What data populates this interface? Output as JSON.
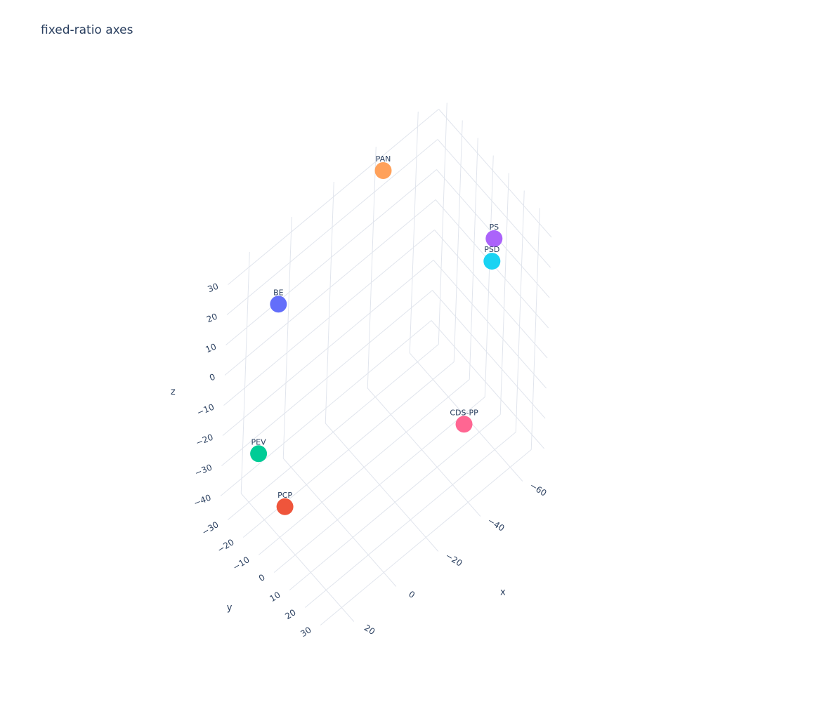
{
  "chart_data": {
    "type": "scatter3d",
    "title": "fixed-ratio axes",
    "xlabel": "x",
    "ylabel": "y",
    "zlabel": "z",
    "xlim": [
      -70,
      30
    ],
    "ylim": [
      -35,
      38
    ],
    "zlim": [
      -45,
      35
    ],
    "x_ticks": [
      "-60",
      "-40",
      "-20",
      "0",
      "20"
    ],
    "y_ticks": [
      "-30",
      "-20",
      "-10",
      "0",
      "10",
      "20",
      "30"
    ],
    "z_ticks": [
      "-40",
      "-30",
      "-20",
      "-10",
      "0",
      "10",
      "20",
      "30"
    ],
    "grid": true,
    "points": [
      {
        "label": "PS",
        "x": -60,
        "y": 15,
        "z": 22,
        "color": "#ab63fa"
      },
      {
        "label": "PSD",
        "x": -57,
        "y": 18,
        "z": 18,
        "color": "#19d3f3"
      },
      {
        "label": "CDS-PP",
        "x": -32,
        "y": 36,
        "z": -11,
        "color": "#ff6692"
      },
      {
        "label": "PAN",
        "x": -40,
        "y": -30,
        "z": 30,
        "color": "#ffa15a"
      },
      {
        "label": "BE",
        "x": 5,
        "y": -35,
        "z": 9,
        "color": "#636efa"
      },
      {
        "label": "PEV",
        "x": 20,
        "y": -25,
        "z": -26,
        "color": "#00cc96"
      },
      {
        "label": "PCP",
        "x": 18,
        "y": -10,
        "z": -36,
        "color": "#ef553b"
      }
    ]
  }
}
